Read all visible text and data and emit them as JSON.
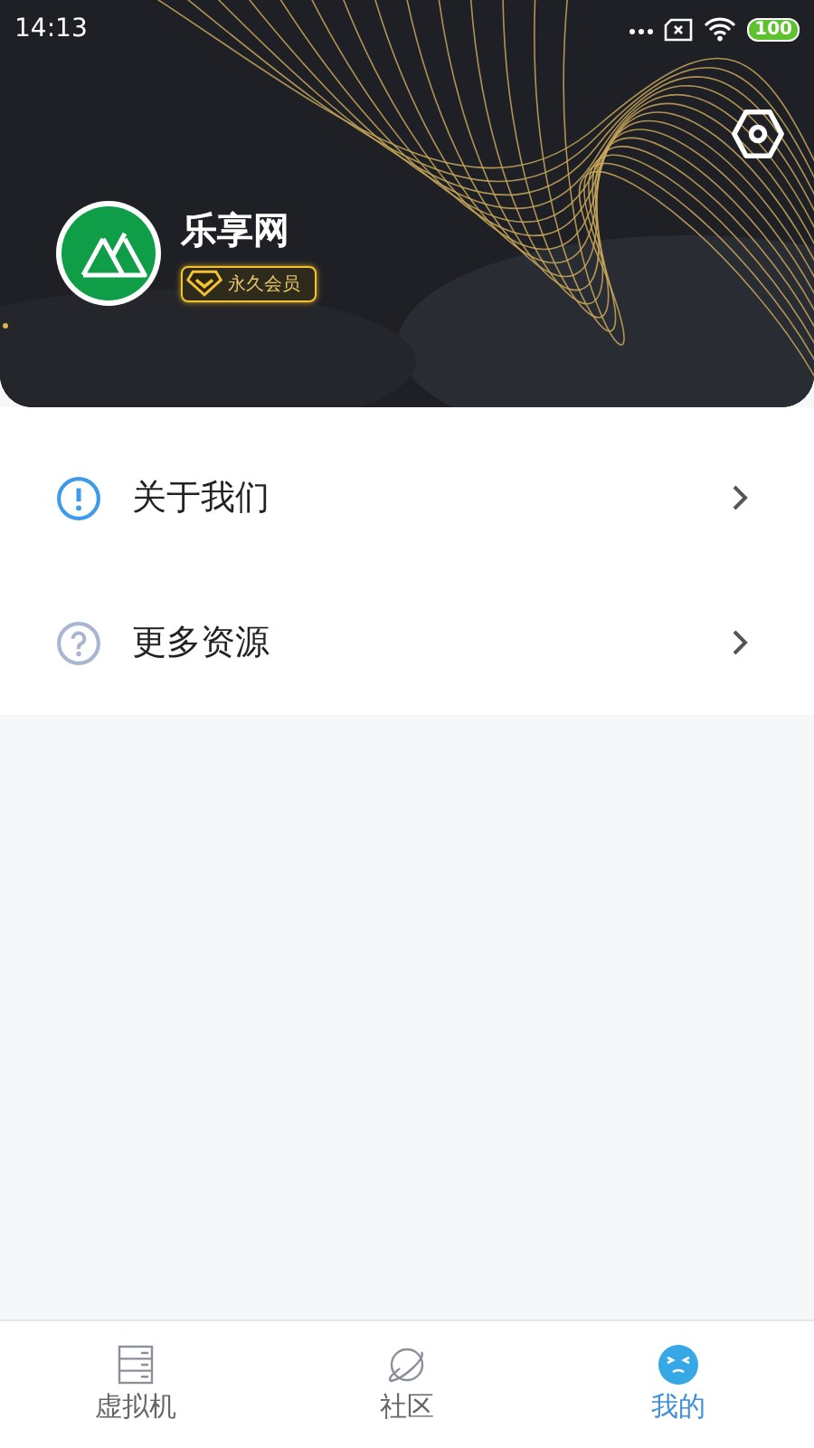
{
  "status_bar": {
    "time": "14:13",
    "battery": "100"
  },
  "profile": {
    "name": "乐享网",
    "badge": "永久会员"
  },
  "menu": [
    {
      "kind": "info",
      "label": "关于我们"
    },
    {
      "kind": "help",
      "label": "更多资源"
    }
  ],
  "tabs": [
    {
      "kind": "server",
      "label": "虚拟机",
      "selected": false
    },
    {
      "kind": "planet",
      "label": "社区",
      "selected": false
    },
    {
      "kind": "face",
      "label": "我的",
      "selected": true
    }
  ]
}
